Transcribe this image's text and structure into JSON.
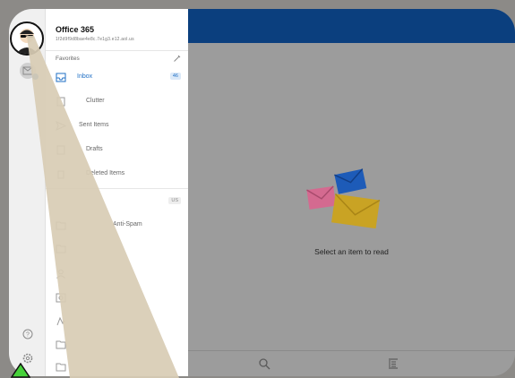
{
  "account": {
    "name": "Office 365",
    "email": "1f2d9f9d8bae4e8c.7e1g3.e12.aol.us"
  },
  "favorites": {
    "label": "Favorites",
    "items": [
      {
        "label": "Inbox",
        "icon": "inbox-icon",
        "badge": "46",
        "active": true
      },
      {
        "label": "Clutter",
        "icon": "clutter-icon"
      },
      {
        "label": "Sent Items",
        "icon": "send-icon"
      },
      {
        "label": "Drafts",
        "icon": "drafts-icon"
      },
      {
        "label": "Deleted Items",
        "icon": "trash-icon"
      }
    ]
  },
  "folders_section": {
    "badge": "US",
    "items": [
      {
        "label": "Anti-Spam",
        "icon": "folder-icon"
      }
    ]
  },
  "reading_pane": {
    "empty_message": "Select an item to read"
  },
  "icons": {
    "rail": [
      "avatar",
      "mail-icon",
      "help-icon",
      "settings-icon"
    ],
    "bottom_bar": [
      "search-icon",
      "filter-icon"
    ]
  },
  "colors": {
    "header": "#0b3f7e",
    "accent": "#1f6fc5",
    "overlay": "#d8ccb4"
  }
}
